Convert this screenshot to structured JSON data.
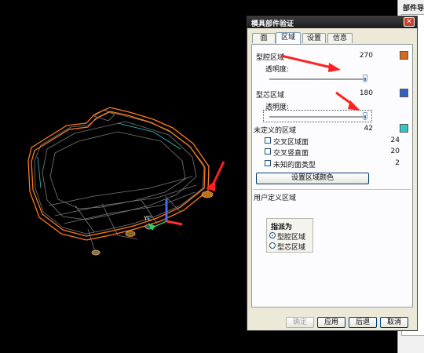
{
  "dialog": {
    "title": "模具部件验证",
    "close_label": "✕",
    "tabs": [
      {
        "label": "面",
        "active": false
      },
      {
        "label": "区域",
        "active": true
      },
      {
        "label": "设置",
        "active": false
      },
      {
        "label": "信息",
        "active": false
      }
    ],
    "cavity_region": {
      "label": "型腔区域",
      "count": "270",
      "color": "#d2691e"
    },
    "cavity_transparency_label": "透明度:",
    "core_region": {
      "label": "型芯区域",
      "count": "180",
      "color": "#2f62c9"
    },
    "core_transparency_label": "透明度:",
    "undefined_region": {
      "label": "未定义的区域",
      "count": "42",
      "color": "#2ec8c8"
    },
    "undefined_items": [
      {
        "label": "交叉区域面",
        "count": "24"
      },
      {
        "label": "交叉竖直面",
        "count": "20"
      },
      {
        "label": "未知的面类型",
        "count": "2"
      }
    ],
    "set_color_button": "设置区域颜色",
    "user_defined_label": "用户定义区域",
    "assign_group": {
      "title": "指派为",
      "options": [
        {
          "label": "型腔区域",
          "selected": true
        },
        {
          "label": "型芯区域",
          "selected": false
        }
      ]
    },
    "footer_buttons": [
      {
        "label": "确定",
        "disabled": true
      },
      {
        "label": "应用",
        "disabled": false
      },
      {
        "label": "后退",
        "disabled": false
      },
      {
        "label": "取消",
        "disabled": false
      }
    ]
  },
  "side_panel": {
    "title": "部件导"
  },
  "viewport": {
    "axis_label": "YC"
  }
}
